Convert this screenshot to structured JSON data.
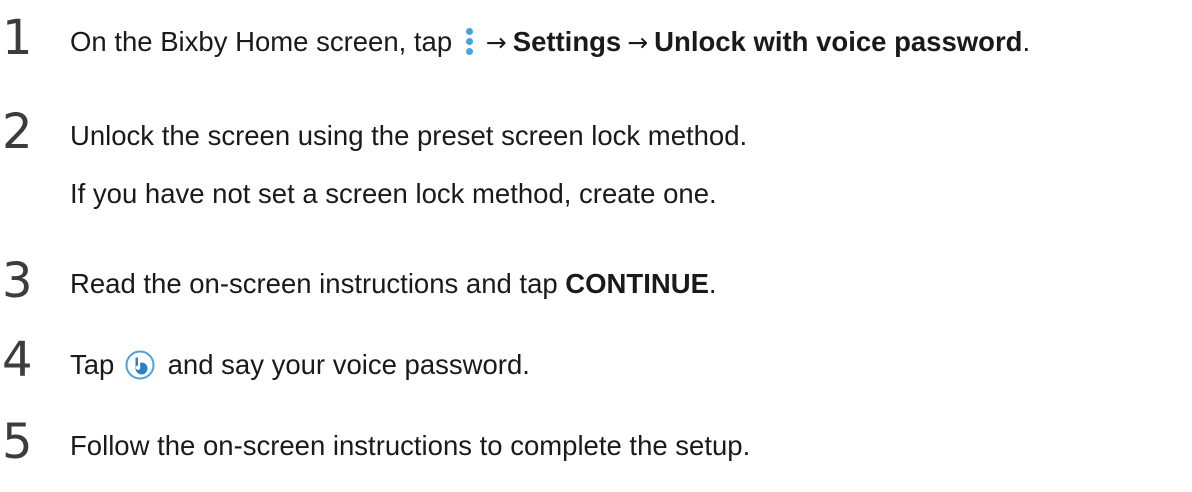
{
  "steps": [
    {
      "number": "1",
      "parts": {
        "text_a": "On the Bixby Home screen, tap ",
        "arrow_1": "→",
        "bold_settings": "Settings",
        "arrow_2": "→",
        "bold_unlock": "Unlock with voice password",
        "end": "."
      },
      "icons": [
        "more-options-icon"
      ]
    },
    {
      "number": "2",
      "line1": "Unlock the screen using the preset screen lock method.",
      "line2": "If you have not set a screen lock method, create one."
    },
    {
      "number": "3",
      "parts": {
        "text_a": "Read the on-screen instructions and tap ",
        "bold_continue": "CONTINUE",
        "end": "."
      }
    },
    {
      "number": "4",
      "parts": {
        "text_a": "Tap ",
        "text_b": " and say your voice password."
      },
      "icons": [
        "bixby-voice-icon"
      ]
    },
    {
      "number": "5",
      "line1": "Follow the on-screen instructions to complete the setup."
    }
  ],
  "colors": {
    "icon_accent": "#4aa3e0",
    "icon_dark": "#2b7fc4",
    "text": "#1a1a1a",
    "number": "#3c3c3c"
  }
}
